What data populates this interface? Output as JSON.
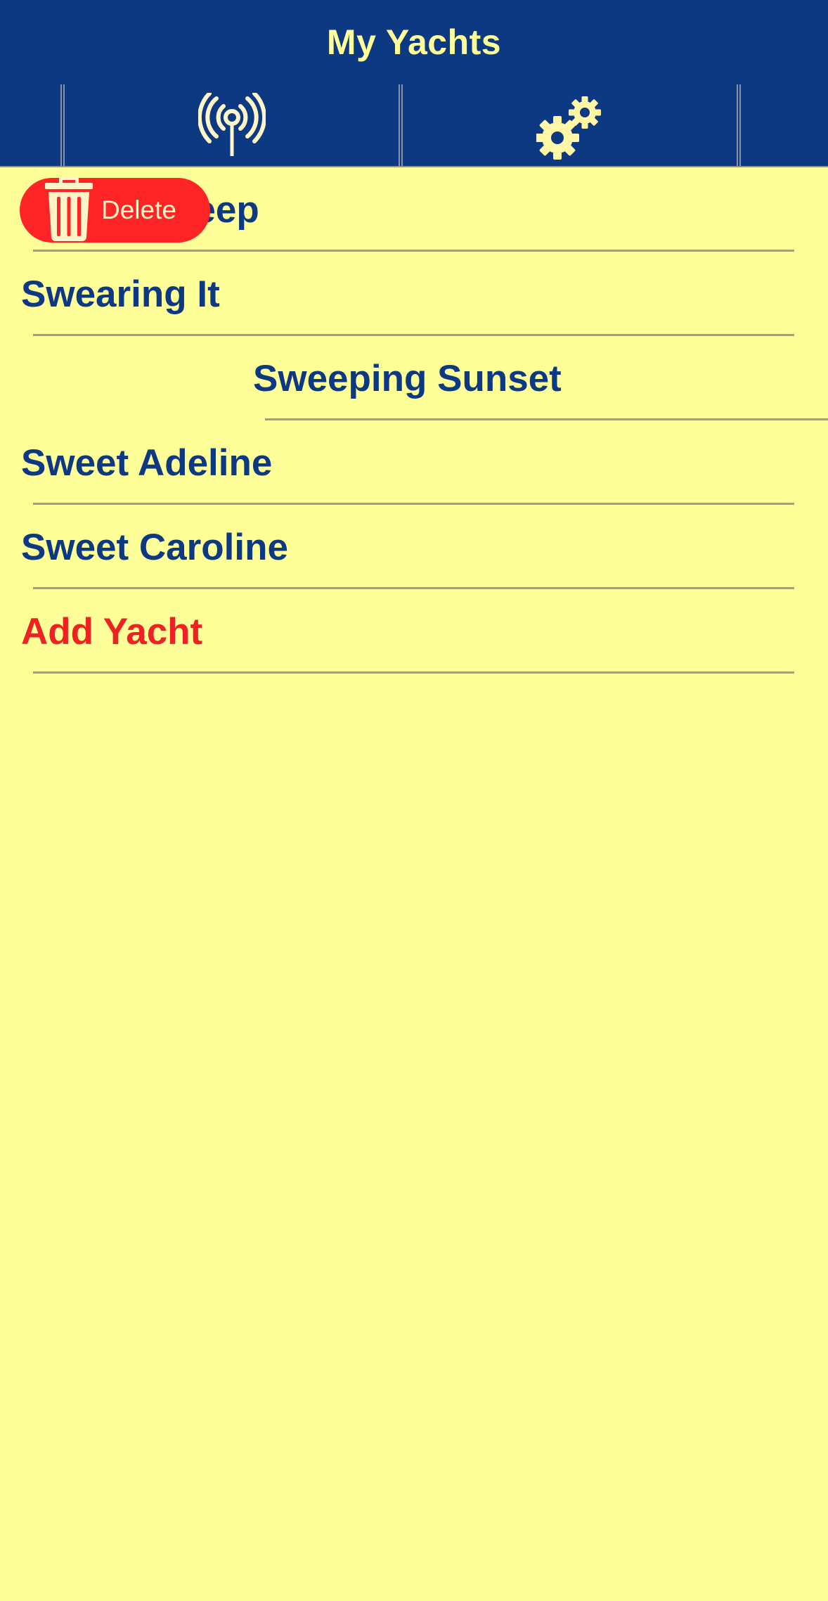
{
  "header": {
    "title": "My Yachts"
  },
  "toolbar": {
    "items": [
      {
        "icon": "broadcast-antenna-icon"
      },
      {
        "icon": "gears-icon"
      }
    ]
  },
  "yachts": [
    {
      "name": "Grand Sweep"
    },
    {
      "name": "Swearing It"
    },
    {
      "name": "Sweeping Sunset",
      "swiped": true
    },
    {
      "name": "Sweet Adeline"
    },
    {
      "name": "Sweet Caroline"
    }
  ],
  "add_yacht_label": "Add Yacht",
  "delete_action": {
    "label": "Delete",
    "icon": "trash-icon"
  },
  "colors": {
    "bar_background": "#0D3882",
    "title_text": "#FFFF99",
    "page_background": "#FFFF99",
    "row_text": "#0D3882",
    "add_text": "#EE2222",
    "delete_background": "#FF2426",
    "separator": "#9C9C92"
  }
}
